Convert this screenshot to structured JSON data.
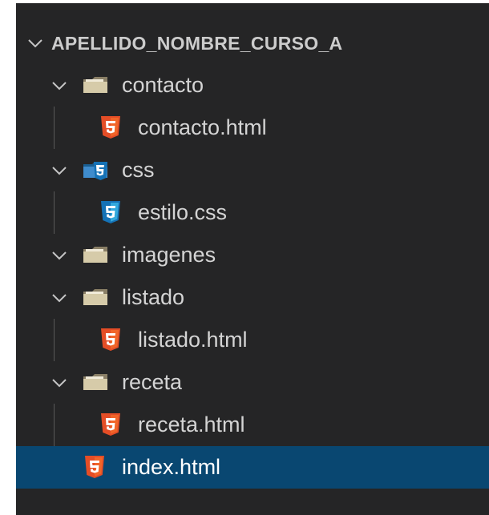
{
  "explorer": {
    "root": {
      "label": "APELLIDO_NOMBRE_CURSO_A",
      "expanded": true,
      "icon": "chevron-down-icon"
    },
    "items": [
      {
        "type": "folder",
        "label": "contacto",
        "expanded": true,
        "icon": "folder-icon"
      },
      {
        "type": "file",
        "label": "contacto.html",
        "icon": "html5-file-icon"
      },
      {
        "type": "folder",
        "label": "css",
        "expanded": true,
        "icon": "css-folder-icon"
      },
      {
        "type": "file",
        "label": "estilo.css",
        "icon": "css3-file-icon"
      },
      {
        "type": "folder",
        "label": "imagenes",
        "expanded": true,
        "icon": "folder-icon"
      },
      {
        "type": "folder",
        "label": "listado",
        "expanded": true,
        "icon": "folder-icon"
      },
      {
        "type": "file",
        "label": "listado.html",
        "icon": "html5-file-icon"
      },
      {
        "type": "folder",
        "label": "receta",
        "expanded": true,
        "icon": "folder-icon"
      },
      {
        "type": "file",
        "label": "receta.html",
        "icon": "html5-file-icon"
      },
      {
        "type": "file",
        "label": "index.html",
        "icon": "html5-file-icon",
        "selected": true
      }
    ]
  },
  "colors": {
    "background": "#252526",
    "text": "#d4d4d4",
    "selection": "#094771",
    "html5": "#e44d26",
    "css3": "#1572b6",
    "folder": "#c5b99a"
  }
}
